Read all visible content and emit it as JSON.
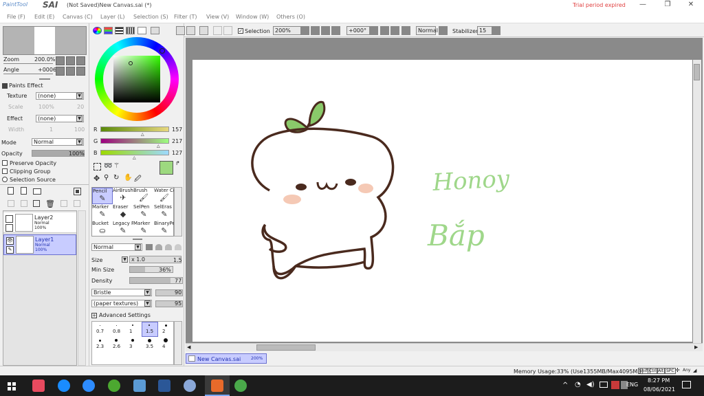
{
  "app": {
    "logo_text": "PaintTool",
    "logo_sai": "SAI",
    "title": "(Not Saved)New Canvas.sai (*)",
    "trial": "Trial period expired"
  },
  "menu": [
    "File (F)",
    "Edit (E)",
    "Canvas (C)",
    "Layer (L)",
    "Selection (S)",
    "Filter (T)",
    "View (V)",
    "Window (W)",
    "Others (O)"
  ],
  "window_buttons": {
    "minimize": "—",
    "maximize": "❐",
    "close": "✕"
  },
  "navigator": {
    "zoom_label": "Zoom",
    "zoom_value": "200.0%",
    "angle_label": "Angle",
    "angle_value": "+0006"
  },
  "paints_effect": {
    "header": "Paints Effect",
    "texture_label": "Texture",
    "texture_value": "(none)",
    "scale_label": "Scale",
    "scale_value": "100%",
    "scale_num": "20",
    "effect_label": "Effect",
    "effect_value": "(none)",
    "width_label": "Width",
    "width_value": "1",
    "width_num": "100"
  },
  "blend": {
    "mode_label": "Mode",
    "mode_value": "Normal",
    "opacity_label": "Opacity",
    "opacity_value": "100%",
    "opacity_level": 1.0
  },
  "checkboxes": {
    "preserve": "Preserve Opacity",
    "clipping": "Clipping Group",
    "selsource": "Selection Source"
  },
  "layers": [
    {
      "name": "Layer2",
      "mode": "Normal",
      "opacity": "100%",
      "selected": false
    },
    {
      "name": "Layer1",
      "mode": "Normal",
      "opacity": "100%",
      "selected": true
    }
  ],
  "color": {
    "r_label": "R",
    "r": "157",
    "g_label": "G",
    "g": "217",
    "b_label": "B",
    "b": "127",
    "swatch": "#9dd97f",
    "r_level": 0.62,
    "g_level": 0.85,
    "b_level": 0.5
  },
  "tools": [
    {
      "name": "Pencil",
      "icon": "✎"
    },
    {
      "name": "AirBrush",
      "icon": "✈"
    },
    {
      "name": "Brush",
      "icon": "🖌"
    },
    {
      "name": "Water Color",
      "icon": "🖌"
    },
    {
      "name": "Marker",
      "icon": "✎"
    },
    {
      "name": "Eraser",
      "icon": "◆"
    },
    {
      "name": "SelPen",
      "icon": "✎"
    },
    {
      "name": "SelEras",
      "icon": "✎"
    },
    {
      "name": "Bucket",
      "icon": "⛀"
    },
    {
      "name": "Legacy Pen",
      "icon": "✎"
    },
    {
      "name": "Marker",
      "icon": "✎"
    },
    {
      "name": "BinaryPe",
      "icon": "✎"
    }
  ],
  "brush": {
    "blend_value": "Normal",
    "size_label": "Size",
    "size_mult": "x 1.0",
    "size_value": "1.5",
    "minsize_label": "Min Size",
    "minsize_value": "36%",
    "minsize_level": 0.36,
    "density_label": "Density",
    "density_value": "77",
    "density_level": 0.77,
    "bristle_value": "Bristle",
    "bristle_num": "90",
    "texture_value": "(paper textures)",
    "texture_num": "95",
    "advanced": "Advanced Settings"
  },
  "brush_sizes": [
    [
      "0.7",
      "0.8",
      "1",
      "1.5",
      "2"
    ],
    [
      "2.3",
      "2.6",
      "3",
      "3.5",
      "4"
    ]
  ],
  "toolbar": {
    "selection_label": "Selection",
    "zoom": "200%",
    "angle": "+000°",
    "blend": "Normal",
    "stabilizer_label": "Stabilizer",
    "stabilizer": "15"
  },
  "canvas": {
    "text1": "Honoy",
    "text2": "Bắp"
  },
  "doc_tab": {
    "name": "New Canvas.sai",
    "zoom": "200%"
  },
  "status": {
    "memory": "Memory Usage:33% (Use1355MB/Max4095MB)",
    "keys": [
      "Shift",
      "Ctrl",
      "Alt",
      "SPC"
    ],
    "any": "Any"
  },
  "taskbar": {
    "lang": "ENG",
    "time": "8:27 PM",
    "date": "08/06/2021"
  },
  "colors": {
    "leaf": "#8ac96a",
    "outline": "#4a2a1e",
    "blush": "#f5c9b5",
    "greentext": "#9fd78a",
    "accent": "#3060d0"
  }
}
